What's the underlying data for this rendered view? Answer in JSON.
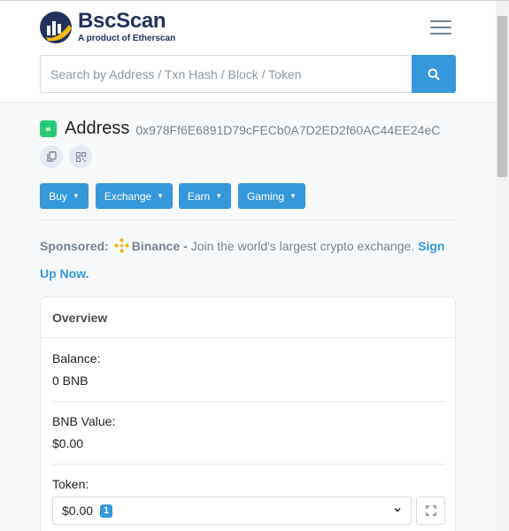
{
  "header": {
    "logo_name": "BscScan",
    "logo_tagline": "A product of Etherscan",
    "menu_icon": "hamburger-menu-icon"
  },
  "search": {
    "placeholder": "Search by Address / Txn Hash / Block / Token",
    "value": "",
    "button_icon": "search-icon"
  },
  "address": {
    "title": "Address",
    "hash": "0x978Ff6E6891D79cFECb0A7D2ED2f60AC44EE24eC",
    "copy_icon": "copy-icon",
    "qr_icon": "qr-code-icon"
  },
  "actions": [
    {
      "label": "Buy"
    },
    {
      "label": "Exchange"
    },
    {
      "label": "Earn"
    },
    {
      "label": "Gaming"
    }
  ],
  "sponsored": {
    "prefix": "Sponsored:",
    "brand": "Binance -",
    "text": "Join the world's largest crypto exchange.",
    "link": "Sign Up Now."
  },
  "overview": {
    "title": "Overview",
    "balance_label": "Balance:",
    "balance_value": "0 BNB",
    "bnb_value_label": "BNB Value:",
    "bnb_value": "$0.00",
    "token_label": "Token:",
    "token_value": "$0.00",
    "token_count": "1"
  },
  "colors": {
    "accent": "#3498db",
    "brand_dark": "#21325b",
    "brand_gold": "#f0b90b",
    "avatar": "#2ecc71"
  }
}
